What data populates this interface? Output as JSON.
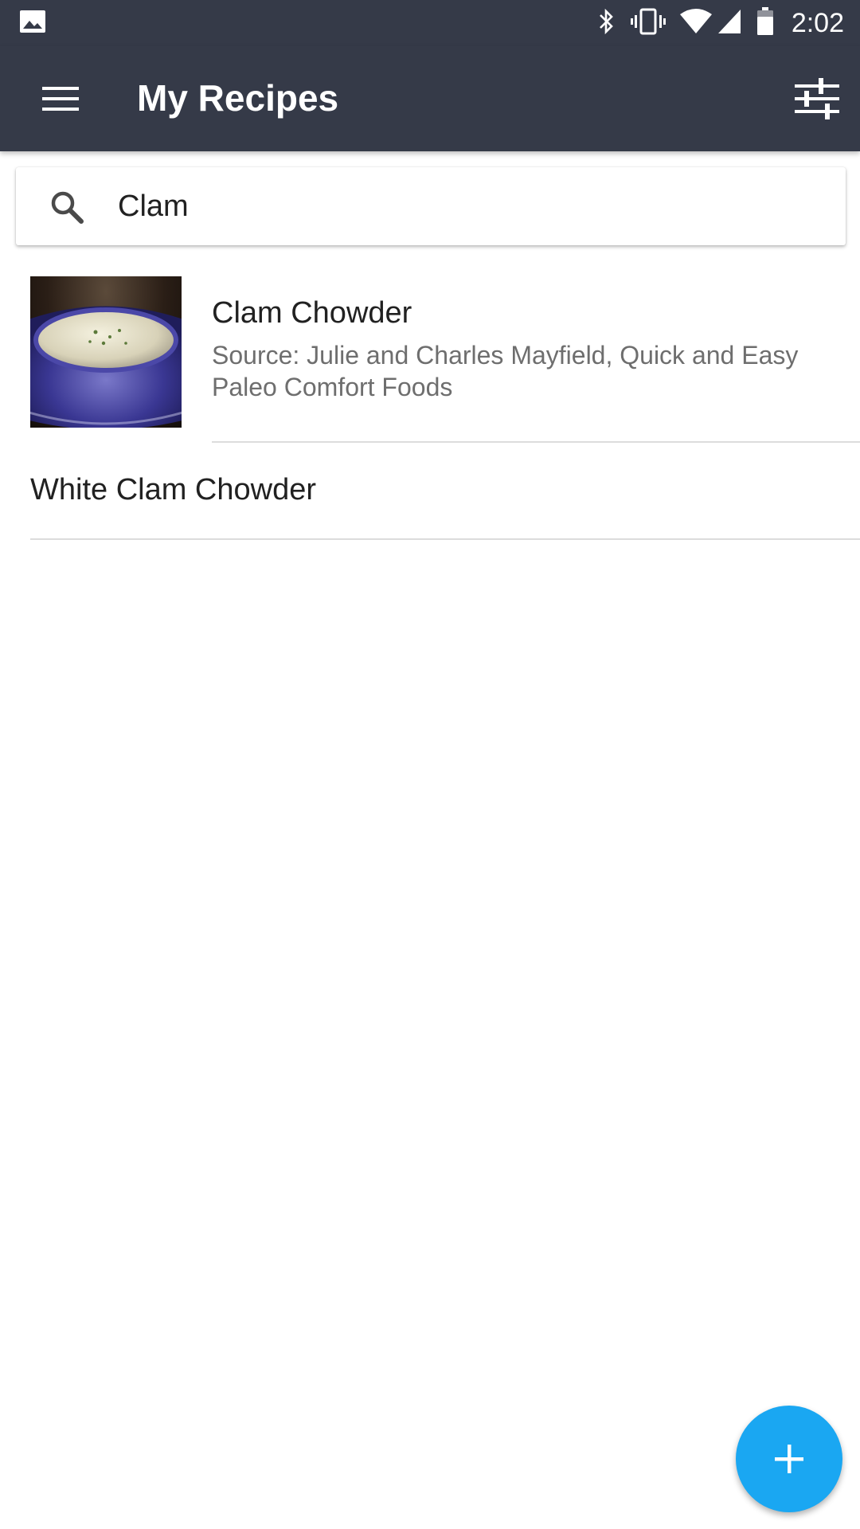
{
  "status_bar": {
    "time": "2:02",
    "icons": [
      "image-notification-icon",
      "bluetooth-icon",
      "vibrate-icon",
      "wifi-icon",
      "cell-signal-icon",
      "battery-icon"
    ]
  },
  "app_bar": {
    "title": "My Recipes",
    "menu_icon": "menu-icon",
    "filter_icon": "tune-icon",
    "color": "#353a48"
  },
  "search": {
    "value": "Clam",
    "icon": "search-icon"
  },
  "recipes": [
    {
      "title": "Clam Chowder",
      "source": "Source: Julie and Charles Mayfield, Quick and Easy Paleo Comfort Foods",
      "has_image": true
    },
    {
      "title": "White Clam Chowder",
      "has_image": false
    }
  ],
  "fab": {
    "icon": "plus-icon",
    "color": "#1aa7f2"
  }
}
